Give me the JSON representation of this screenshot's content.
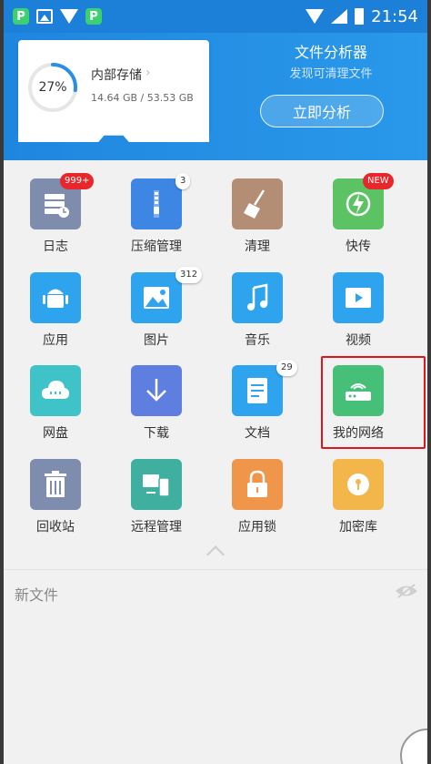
{
  "status_bar": {
    "time": "21:54"
  },
  "header": {
    "storage": {
      "percent": "27%",
      "percent_value": 27,
      "title": "内部存储",
      "size": "14.64 GB / 53.53 GB"
    },
    "analyzer": {
      "title": "文件分析器",
      "subtitle": "发现可清理文件",
      "button": "立即分析"
    }
  },
  "tiles": [
    {
      "label": "日志",
      "icon": "log-icon",
      "badge": "999+",
      "color": "#7e8cad"
    },
    {
      "label": "压缩管理",
      "icon": "zip-icon",
      "badge": "3",
      "color": "#3e86e3"
    },
    {
      "label": "清理",
      "icon": "broom-icon",
      "badge": "",
      "color": "#b38d74"
    },
    {
      "label": "快传",
      "icon": "share-icon",
      "badge": "NEW",
      "color": "#5cc364"
    },
    {
      "label": "应用",
      "icon": "android-icon",
      "badge": "",
      "color": "#2ea4ef"
    },
    {
      "label": "图片",
      "icon": "image-icon",
      "badge": "312",
      "color": "#2ea4ef"
    },
    {
      "label": "音乐",
      "icon": "music-icon",
      "badge": "",
      "color": "#2ea4ef"
    },
    {
      "label": "视频",
      "icon": "video-icon",
      "badge": "",
      "color": "#2ea4ef"
    },
    {
      "label": "网盘",
      "icon": "cloud-icon",
      "badge": "",
      "color": "#3fc2c8"
    },
    {
      "label": "下载",
      "icon": "download-icon",
      "badge": "",
      "color": "#5f7fe0"
    },
    {
      "label": "文档",
      "icon": "document-icon",
      "badge": "29",
      "color": "#2ea4ef"
    },
    {
      "label": "我的网络",
      "icon": "router-icon",
      "badge": "",
      "color": "#46bf78"
    },
    {
      "label": "回收站",
      "icon": "trash-icon",
      "badge": "",
      "color": "#7e8cad"
    },
    {
      "label": "远程管理",
      "icon": "remote-icon",
      "badge": "",
      "color": "#3fb0a0"
    },
    {
      "label": "应用锁",
      "icon": "lock-icon",
      "badge": "",
      "color": "#f0964a"
    },
    {
      "label": "加密库",
      "icon": "safe-icon",
      "badge": "",
      "color": "#f2b64a"
    }
  ],
  "recent": {
    "label": "新文件"
  }
}
